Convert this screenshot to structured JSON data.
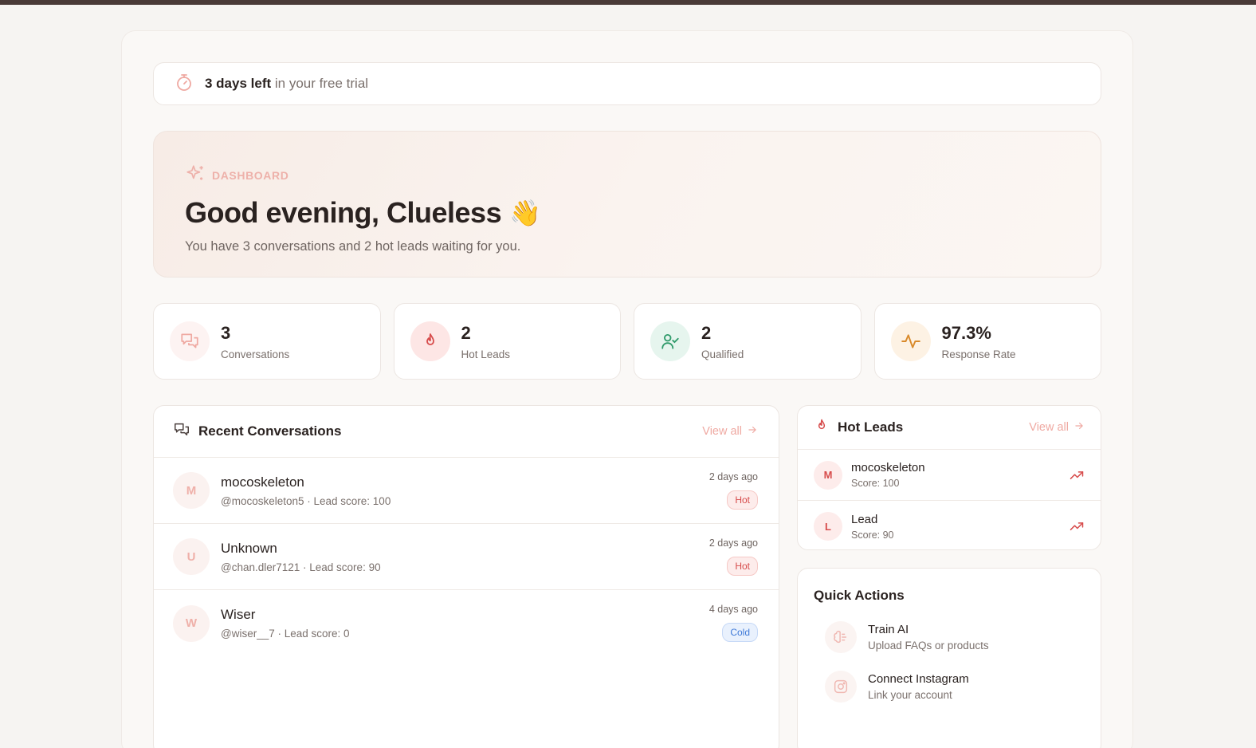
{
  "trial": {
    "strong": "3 days left",
    "rest": "in your free trial"
  },
  "hero": {
    "eyebrow": "DASHBOARD",
    "greeting": "Good evening, Clueless",
    "emoji": "👋",
    "subtitle": "You have 3 conversations and 2 hot leads waiting for you."
  },
  "stats": [
    {
      "value": "3",
      "label": "Conversations",
      "icon": "chat-icon"
    },
    {
      "value": "2",
      "label": "Hot Leads",
      "icon": "flame-icon"
    },
    {
      "value": "2",
      "label": "Qualified",
      "icon": "user-check-icon"
    },
    {
      "value": "97.3%",
      "label": "Response Rate",
      "icon": "activity-icon"
    }
  ],
  "recent": {
    "title": "Recent Conversations",
    "view_all": "View all",
    "items": [
      {
        "initial": "M",
        "name": "mocoskeleton",
        "meta": "@mocoskeleton5 · Lead score: 100",
        "time": "2 days ago",
        "badge": "Hot"
      },
      {
        "initial": "U",
        "name": "Unknown",
        "meta": "@chan.dler7121 · Lead score: 90",
        "time": "2 days ago",
        "badge": "Hot"
      },
      {
        "initial": "W",
        "name": "Wiser",
        "meta": "@wiser__7 · Lead score: 0",
        "time": "4 days ago",
        "badge": "Cold"
      }
    ]
  },
  "hot_leads": {
    "title": "Hot Leads",
    "view_all": "View all",
    "items": [
      {
        "initial": "M",
        "name": "mocoskeleton",
        "score": "Score: 100"
      },
      {
        "initial": "L",
        "name": "Lead",
        "score": "Score: 90"
      }
    ]
  },
  "quick_actions": {
    "title": "Quick Actions",
    "items": [
      {
        "name": "Train AI",
        "desc": "Upload FAQs or products",
        "icon": "brain-icon"
      },
      {
        "name": "Connect Instagram",
        "desc": "Link your account",
        "icon": "instagram-icon"
      }
    ]
  },
  "colors": {
    "accent": "#efa9a2",
    "hot": "#d74c4c",
    "cold": "#3f7ad8",
    "qualified": "#2f9a6a",
    "rate": "#d98a2b"
  }
}
